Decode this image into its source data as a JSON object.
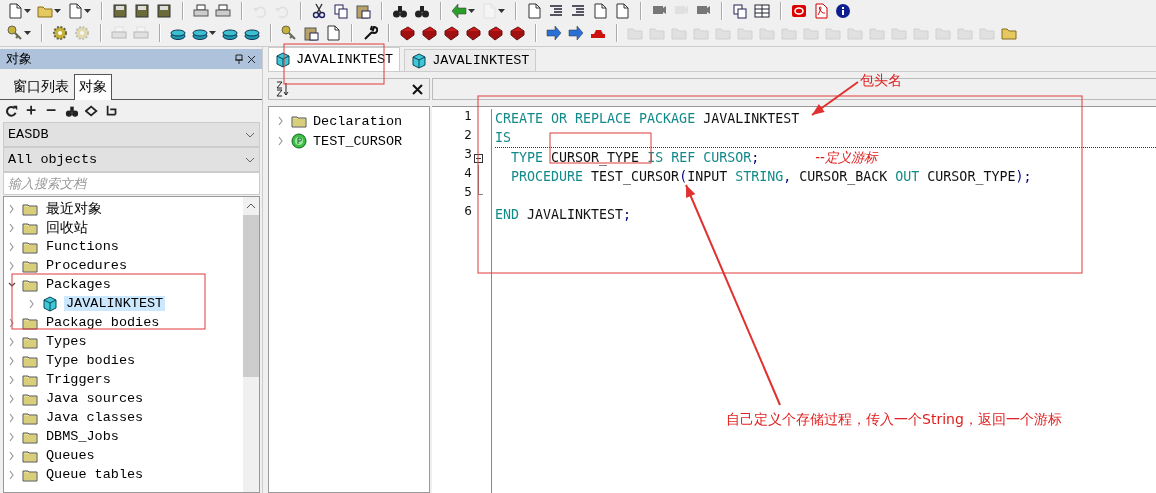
{
  "left_panel": {
    "title": "对象",
    "tabs": [
      {
        "label": "窗口列表",
        "selected": false
      },
      {
        "label": "对象",
        "selected": true
      }
    ],
    "connection": "EASDB",
    "filter": "All objects",
    "search": {
      "placeholder": "输入搜索文档"
    },
    "tree": [
      {
        "label": "最近对象",
        "expanded": false,
        "selected": false
      },
      {
        "label": "回收站",
        "expanded": false,
        "selected": false
      },
      {
        "label": "Functions",
        "expanded": false,
        "selected": false
      },
      {
        "label": "Procedures",
        "expanded": false,
        "selected": false
      },
      {
        "label": "Packages",
        "expanded": true,
        "selected": false,
        "children": [
          {
            "label": "JAVALINKTEST",
            "kind": "package",
            "expanded": false,
            "selected": true
          }
        ]
      },
      {
        "label": "Package bodies",
        "expanded": false,
        "selected": false
      },
      {
        "label": "Types",
        "expanded": false,
        "selected": false
      },
      {
        "label": "Type bodies",
        "expanded": false,
        "selected": false
      },
      {
        "label": "Triggers",
        "expanded": false,
        "selected": false
      },
      {
        "label": "Java sources",
        "expanded": false,
        "selected": false
      },
      {
        "label": "Java classes",
        "expanded": false,
        "selected": false
      },
      {
        "label": "DBMS_Jobs",
        "expanded": false,
        "selected": false
      },
      {
        "label": "Queues",
        "expanded": false,
        "selected": false
      },
      {
        "label": "Queue tables",
        "expanded": false,
        "selected": false
      }
    ]
  },
  "editor_tabs": [
    {
      "label": "JAVALINKTEST",
      "selected": true
    },
    {
      "label": "JAVALINKTEST",
      "selected": false
    }
  ],
  "outline": {
    "items": [
      {
        "label": "Declaration",
        "kind": "folder",
        "expanded": false
      },
      {
        "label": "TEST_CURSOR",
        "kind": "procedure",
        "expanded": false
      }
    ]
  },
  "code_lines": [
    {
      "number": "1",
      "tokens": [
        {
          "kind": "keyword",
          "text": "CREATE OR REPLACE PACKAGE"
        },
        {
          "kind": "name",
          "text": " JAVALINKTEST"
        }
      ]
    },
    {
      "number": "2",
      "tokens": [
        {
          "kind": "keyword",
          "text": "IS"
        }
      ]
    },
    {
      "number": "3",
      "tokens": [
        {
          "kind": "keyword",
          "text": "  TYPE"
        },
        {
          "kind": "name",
          "text": " CURSOR_TYPE "
        },
        {
          "kind": "keyword",
          "text": "IS REF CURSOR"
        },
        {
          "kind": "punct",
          "text": ";"
        },
        {
          "kind": "note",
          "text": "--定义游标"
        }
      ]
    },
    {
      "number": "4",
      "tokens": [
        {
          "kind": "keyword",
          "text": "  PROCEDURE"
        },
        {
          "kind": "name",
          "text": " TEST_CURSOR"
        },
        {
          "kind": "punct",
          "text": "("
        },
        {
          "kind": "name",
          "text": "INPUT"
        },
        {
          "kind": "keyword",
          "text": " STRING"
        },
        {
          "kind": "punct",
          "text": ", "
        },
        {
          "kind": "name",
          "text": "CURSOR_BACK"
        },
        {
          "kind": "keyword",
          "text": " OUT"
        },
        {
          "kind": "name",
          "text": " CURSOR_TYPE"
        },
        {
          "kind": "punct",
          "text": ");"
        }
      ]
    },
    {
      "number": "5"
    },
    {
      "number": "6",
      "tokens": [
        {
          "kind": "keyword",
          "text": "END"
        },
        {
          "kind": "name",
          "text": " JAVALINKTEST"
        },
        {
          "kind": "punct",
          "text": ";"
        }
      ]
    }
  ],
  "annotations": [
    {
      "text": "包头名"
    },
    {
      "text": "自己定义个存储过程，传入一个String，返回一个游标"
    }
  ]
}
